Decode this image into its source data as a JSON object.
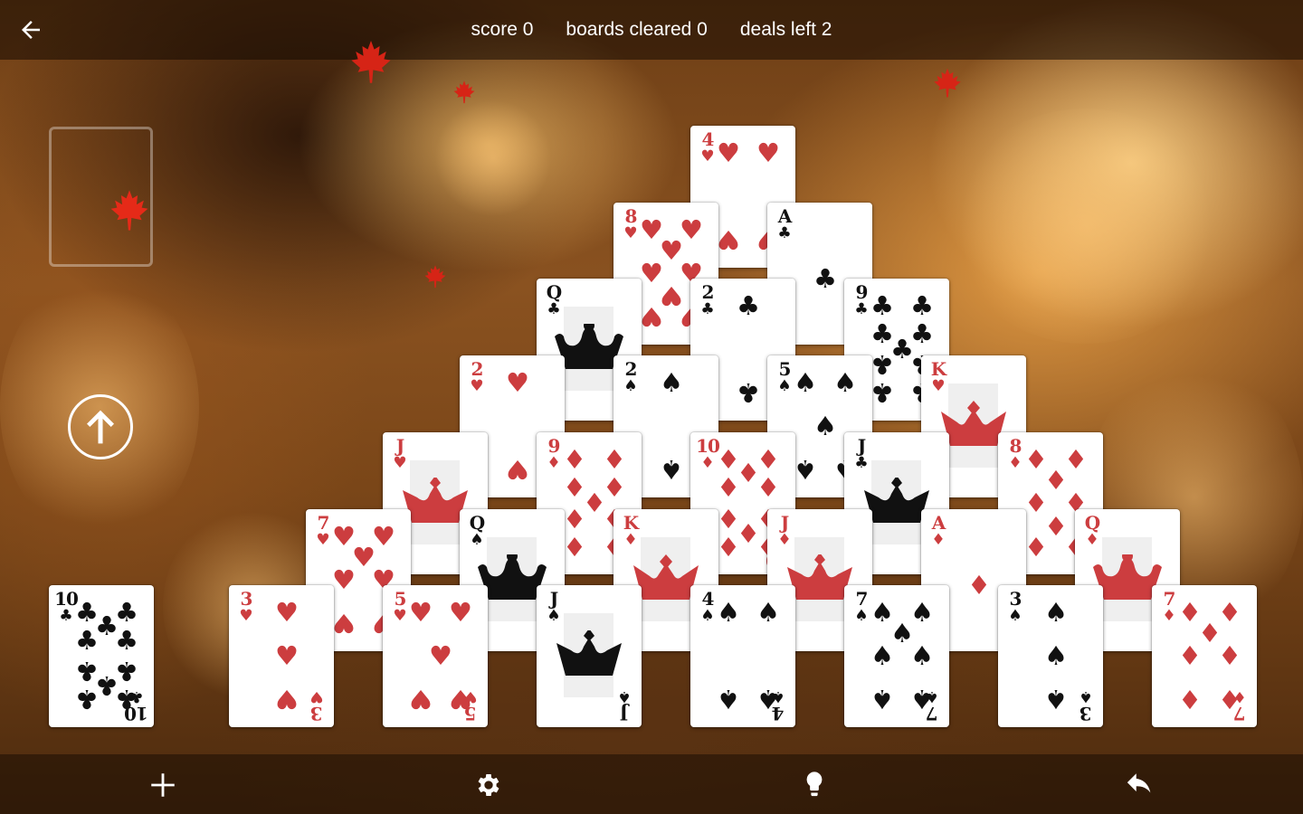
{
  "header": {
    "back_icon": "arrow-left-icon",
    "score_label": "score 0",
    "boards_cleared_label": "boards cleared 0",
    "deals_left_label": "deals left 2"
  },
  "colors": {
    "red_suit": "#cc3d3f",
    "black_suit": "#111111",
    "face_bg": "#efefef"
  },
  "stock": {
    "empty_slot": true,
    "recycle_icon": "arrow-up-circle-icon"
  },
  "waste_card": {
    "rank": "10",
    "suit": "♣"
  },
  "pyramid": [
    [
      {
        "rank": "4",
        "suit": "♥"
      }
    ],
    [
      {
        "rank": "8",
        "suit": "♥"
      },
      {
        "rank": "A",
        "suit": "♣"
      }
    ],
    [
      {
        "rank": "Q",
        "suit": "♣"
      },
      {
        "rank": "2",
        "suit": "♣"
      },
      {
        "rank": "9",
        "suit": "♣"
      }
    ],
    [
      {
        "rank": "2",
        "suit": "♥"
      },
      {
        "rank": "2",
        "suit": "♠"
      },
      {
        "rank": "5",
        "suit": "♠"
      },
      {
        "rank": "K",
        "suit": "♥"
      }
    ],
    [
      {
        "rank": "J",
        "suit": "♥"
      },
      {
        "rank": "9",
        "suit": "♦"
      },
      {
        "rank": "10",
        "suit": "♦"
      },
      {
        "rank": "J",
        "suit": "♣"
      },
      {
        "rank": "8",
        "suit": "♦"
      }
    ],
    [
      {
        "rank": "7",
        "suit": "♥"
      },
      {
        "rank": "Q",
        "suit": "♠"
      },
      {
        "rank": "K",
        "suit": "♦"
      },
      {
        "rank": "J",
        "suit": "♦"
      },
      {
        "rank": "A",
        "suit": "♦"
      },
      {
        "rank": "Q",
        "suit": "♦"
      }
    ],
    [
      {
        "rank": "3",
        "suit": "♥"
      },
      {
        "rank": "5",
        "suit": "♥"
      },
      {
        "rank": "J",
        "suit": "♠"
      },
      {
        "rank": "4",
        "suit": "♠"
      },
      {
        "rank": "7",
        "suit": "♠"
      },
      {
        "rank": "3",
        "suit": "♠"
      },
      {
        "rank": "7",
        "suit": "♦"
      }
    ]
  ],
  "toolbar": {
    "new_game_icon": "plus-icon",
    "settings_icon": "gear-icon",
    "hint_icon": "lightbulb-icon",
    "undo_icon": "undo-icon"
  }
}
